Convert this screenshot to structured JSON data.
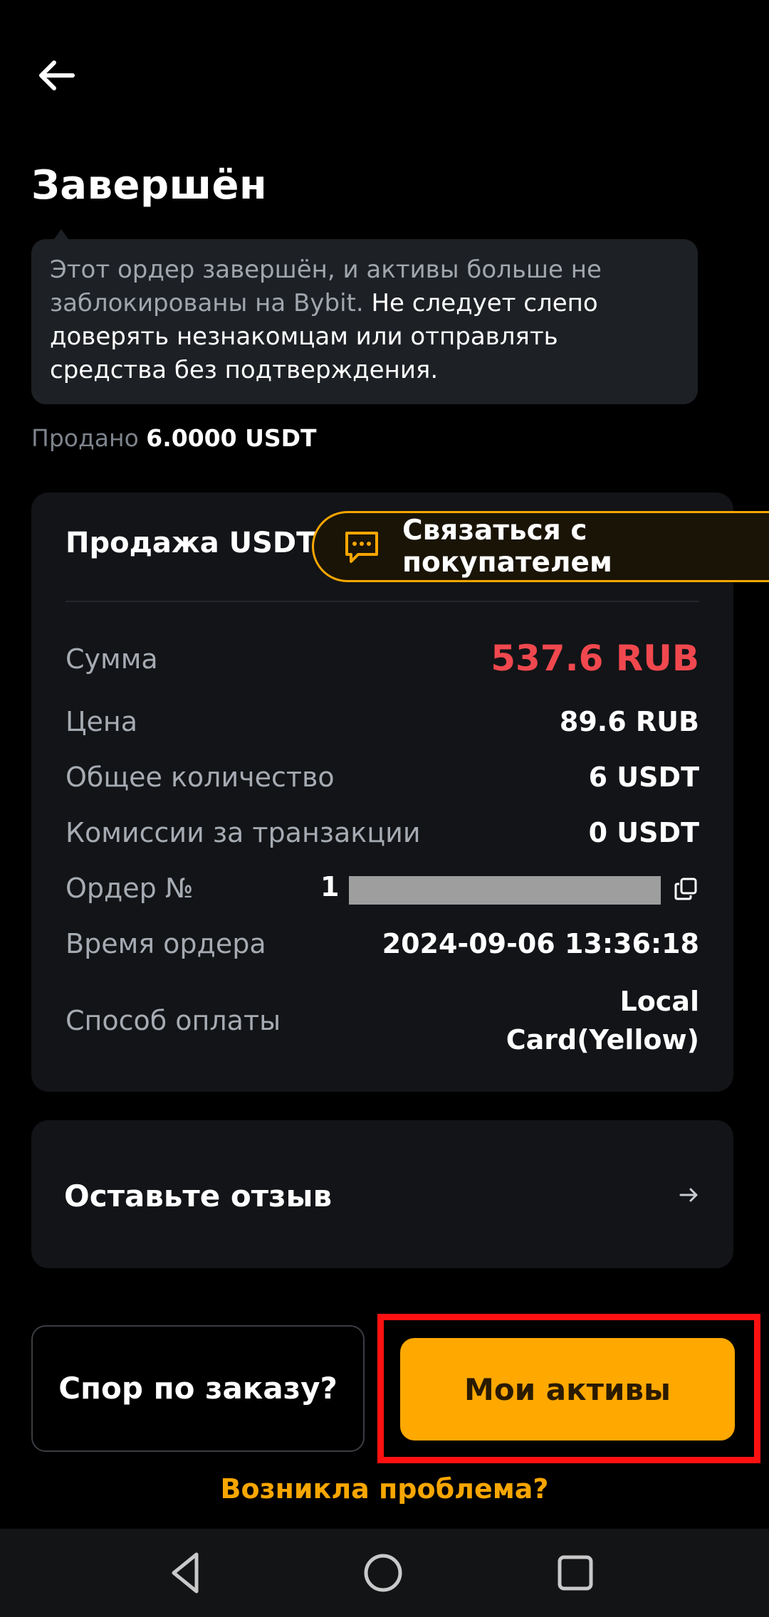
{
  "header": {
    "title": "Завершён"
  },
  "notice": {
    "muted_text": "Этот ордер завершён, и активы больше не заблокированы на Bybit.",
    "warning_text": " Не следует слепо доверять незнакомцам или отправлять средства без подтверждения."
  },
  "sold": {
    "label": "Продано",
    "amount": "6.0000 USDT"
  },
  "order_card": {
    "title": "Продажа USDT",
    "contact_label": "Связаться с покупателем",
    "rows": [
      {
        "label": "Сумма",
        "value": "537.6 RUB"
      },
      {
        "label": "Цена",
        "value": "89.6 RUB"
      },
      {
        "label": "Общее количество",
        "value": "6 USDT"
      },
      {
        "label": "Комиссии за транзакции",
        "value": "0 USDT"
      },
      {
        "label": "Ордер №",
        "value": "1"
      },
      {
        "label": "Время ордера",
        "value": "2024-09-06 13:36:18"
      },
      {
        "label": "Способ оплаты",
        "value_line1": "Local",
        "value_line2": "Card(Yellow)"
      }
    ]
  },
  "review": {
    "label": "Оставьте отзыв"
  },
  "actions": {
    "dispute_label": "Спор по заказу?",
    "assets_label": "Мои активы",
    "problem_link": "Возникла проблема?"
  },
  "colors": {
    "accent": "#f7a600",
    "amount_red": "#f0484e",
    "card_bg": "#121417"
  },
  "icons": [
    "back-arrow-icon",
    "chat-icon",
    "copy-icon",
    "arrow-right-icon",
    "nav-back-icon",
    "nav-home-icon",
    "nav-recents-icon"
  ]
}
